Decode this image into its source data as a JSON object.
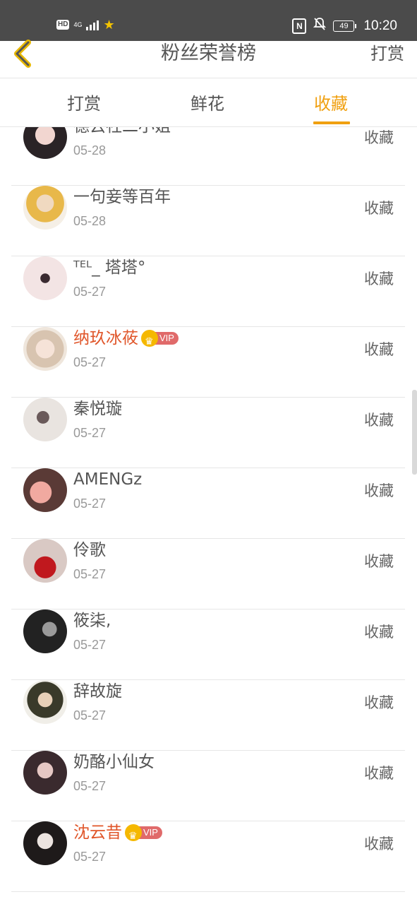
{
  "status_bar": {
    "left_badges": [
      "HD",
      "4G"
    ],
    "time": "10:20",
    "battery": "49",
    "nfc": "N"
  },
  "nav": {
    "title": "粉丝荣誉榜",
    "action": "打赏",
    "back_icon": "chevron-left-icon"
  },
  "tabs": [
    {
      "label": "打赏",
      "active": false
    },
    {
      "label": "鲜花",
      "active": false
    },
    {
      "label": "收藏",
      "active": true
    }
  ],
  "accent_color": "#f0a010",
  "vip_name_color": "#e0562a",
  "vip_badge_text": "VIP",
  "fans": [
    {
      "name": "德云社二小姐",
      "date": "05-28",
      "action": "收藏",
      "vip": false
    },
    {
      "name": "一句妾等百年",
      "date": "05-28",
      "action": "收藏",
      "vip": false
    },
    {
      "name": "ᵀᴱᴸ_ 塔塔°",
      "date": "05-27",
      "action": "收藏",
      "vip": false
    },
    {
      "name": "纳玖冰莜",
      "date": "05-27",
      "action": "收藏",
      "vip": true
    },
    {
      "name": "秦悦璇",
      "date": "05-27",
      "action": "收藏",
      "vip": false
    },
    {
      "name": "AMENGz",
      "date": "05-27",
      "action": "收藏",
      "vip": false
    },
    {
      "name": "伶歌",
      "date": "05-27",
      "action": "收藏",
      "vip": false
    },
    {
      "name": "筱柒,",
      "date": "05-27",
      "action": "收藏",
      "vip": false
    },
    {
      "name": "辞故旋",
      "date": "05-27",
      "action": "收藏",
      "vip": false
    },
    {
      "name": "奶酪小仙女",
      "date": "05-27",
      "action": "收藏",
      "vip": false
    },
    {
      "name": "沈云昔",
      "date": "05-27",
      "action": "收藏",
      "vip": true
    }
  ]
}
